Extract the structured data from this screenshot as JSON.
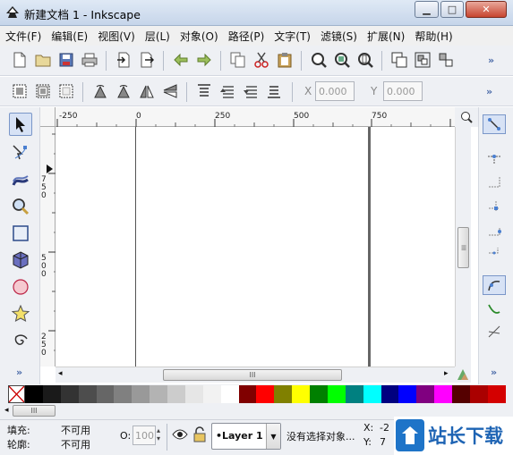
{
  "window": {
    "title": "新建文档 1 - Inkscape",
    "min_label": "▁",
    "max_label": "□",
    "close_label": "✕"
  },
  "menu": [
    "文件(F)",
    "编辑(E)",
    "视图(V)",
    "层(L)",
    "对象(O)",
    "路径(P)",
    "文字(T)",
    "滤镜(S)",
    "扩展(N)",
    "帮助(H)"
  ],
  "toolbar": {
    "more": "»",
    "x_label": "X",
    "x_value": "0.000",
    "y_label": "Y",
    "y_value": "0.000"
  },
  "ruler": {
    "h_ticks": [
      "-250",
      "0",
      "250",
      "500",
      "750"
    ],
    "v_ticks": [
      "750",
      "500",
      "250"
    ]
  },
  "scrollbar": {
    "grip": "III"
  },
  "palette": [
    "#ffffff",
    "#000000",
    "#1a1a1a",
    "#333333",
    "#4d4d4d",
    "#666666",
    "#808080",
    "#999999",
    "#b3b3b3",
    "#cccccc",
    "#e6e6e6",
    "#f2f2f2",
    "#ffffff",
    "#800000",
    "#ff0000",
    "#808000",
    "#ffff00",
    "#008000",
    "#00ff00",
    "#008080",
    "#00ffff",
    "#000080",
    "#0000ff",
    "#800080",
    "#ff00ff",
    "#550000",
    "#aa0000",
    "#d40000"
  ],
  "status": {
    "fill_label": "填充:",
    "fill_value": "不可用",
    "stroke_label": "轮廓:",
    "stroke_value": "不可用",
    "opacity_label": "O:",
    "opacity_value": "100",
    "layer": "•Layer 1",
    "message": "没有选择对象...",
    "coord_x_label": "X:",
    "coord_x_value": "-2",
    "coord_y_label": "Y:",
    "coord_y_value": "7",
    "watermark": "站长下载"
  }
}
